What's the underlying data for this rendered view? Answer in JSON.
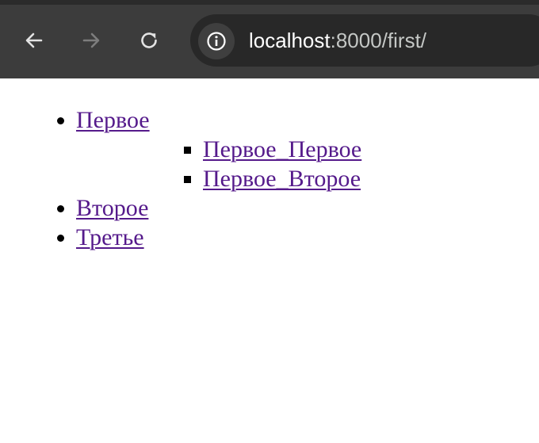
{
  "browser": {
    "back_icon": "arrow-left-icon",
    "forward_icon": "arrow-right-icon",
    "reload_icon": "reload-icon",
    "site_info_icon": "info-icon",
    "url_host": "localhost",
    "url_rest": ":8000/first/"
  },
  "menu": {
    "items": [
      {
        "label": "Первое",
        "children": [
          {
            "label": "Первое_Первое"
          },
          {
            "label": "Первое_Второе"
          }
        ]
      },
      {
        "label": "Второе"
      },
      {
        "label": "Третье"
      }
    ]
  },
  "colors": {
    "toolbar": "#3c3c3c",
    "omnibox": "#282828",
    "link_visited": "#551a8b"
  }
}
